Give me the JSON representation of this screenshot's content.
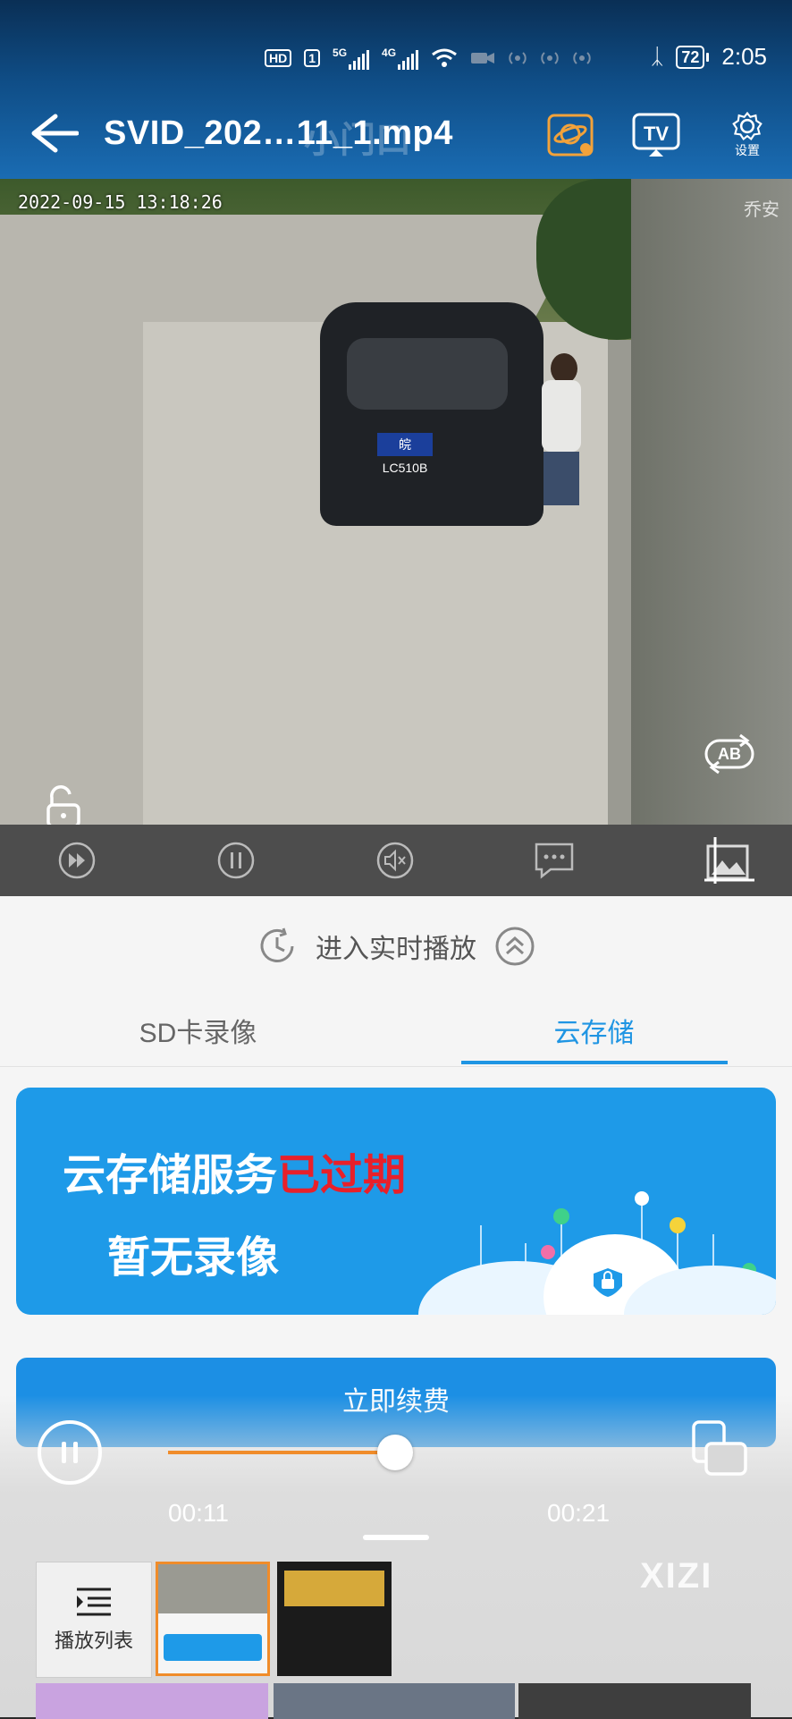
{
  "status_bar": {
    "hd_label": "HD",
    "sim1": "1",
    "net1": "5G",
    "net2": "4G",
    "battery": "72",
    "time": "2:05"
  },
  "header": {
    "title": "SVID_202…11_1.mp4",
    "watermark": "小门口",
    "settings_label": "设置",
    "tv_label": "TV"
  },
  "video": {
    "timestamp": "2022-09-15  13:18:26",
    "plate": "皖LC510B",
    "brand": "乔安",
    "ab_label": "AB"
  },
  "sheet": {
    "live_label": "进入实时播放",
    "tabs": [
      {
        "label": "SD卡录像",
        "active": false
      },
      {
        "label": "云存储",
        "active": true
      }
    ],
    "banner_line1_a": "云存储服务",
    "banner_line1_b": "已过期",
    "banner_line2": "暂无录像",
    "renew_label": "立即续费"
  },
  "player": {
    "current_time": "00:11",
    "total_time": "00:21",
    "progress": 0.5238,
    "playlist_label": "播放列表",
    "watermark": "XIZI"
  },
  "colors": {
    "accent": "#1f95e3",
    "progress": "#f08c2a",
    "expired": "#e8202a"
  }
}
